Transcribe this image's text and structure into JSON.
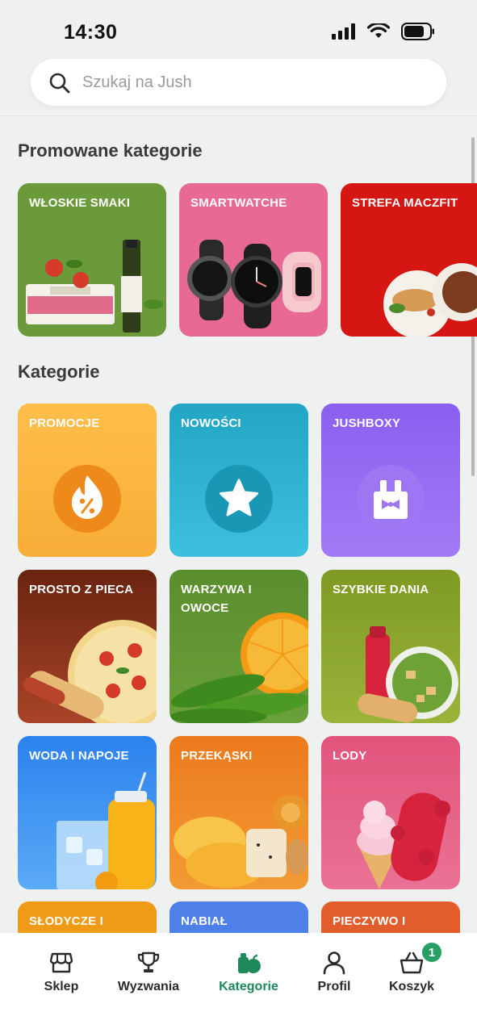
{
  "status": {
    "time": "14:30"
  },
  "search": {
    "placeholder": "Szukaj na Jush"
  },
  "sections": {
    "promoted_title": "Promowane kategorie",
    "categories_title": "Kategorie"
  },
  "promoted": [
    {
      "label": "WŁOSKIE SMAKI",
      "color": "#6b9a3a"
    },
    {
      "label": "SMARTWATCHE",
      "color": "#e86a94"
    },
    {
      "label": "STREFA MACZFIT",
      "color": "#d51613"
    }
  ],
  "categories": [
    {
      "label": "PROMOCJE",
      "color": "#fbb440",
      "icon": "flame-percent-icon"
    },
    {
      "label": "NOWOŚCI",
      "color": "#25aecd",
      "icon": "star-icon"
    },
    {
      "label": "JUSHBOXY",
      "color": "#8d63ef",
      "icon": "gift-box-icon"
    },
    {
      "label": "PROSTO Z PIECA",
      "color": "#85301a"
    },
    {
      "label": "WARZYWA I OWOCE",
      "color": "#5e9330"
    },
    {
      "label": "SZYBKIE DANIA",
      "color": "#8ba52a"
    },
    {
      "label": "WODA I NAPOJE",
      "color": "#2f8ef0"
    },
    {
      "label": "PRZEKĄSKI",
      "color": "#f08524"
    },
    {
      "label": "LODY",
      "color": "#e35d83"
    },
    {
      "label": "SŁODYCZE I",
      "color": "#ef9b18"
    },
    {
      "label": "NABIAŁ",
      "color": "#4f80ea"
    },
    {
      "label": "PIECZYWO I",
      "color": "#e35c2c"
    }
  ],
  "nav": {
    "items": [
      {
        "label": "Sklep",
        "icon": "store-icon"
      },
      {
        "label": "Wyzwania",
        "icon": "trophy-icon"
      },
      {
        "label": "Kategorie",
        "icon": "categories-icon",
        "active": true
      },
      {
        "label": "Profil",
        "icon": "person-icon"
      },
      {
        "label": "Koszyk",
        "icon": "basket-icon"
      }
    ],
    "cart_badge": "1",
    "active_color": "#1e8a5a"
  }
}
